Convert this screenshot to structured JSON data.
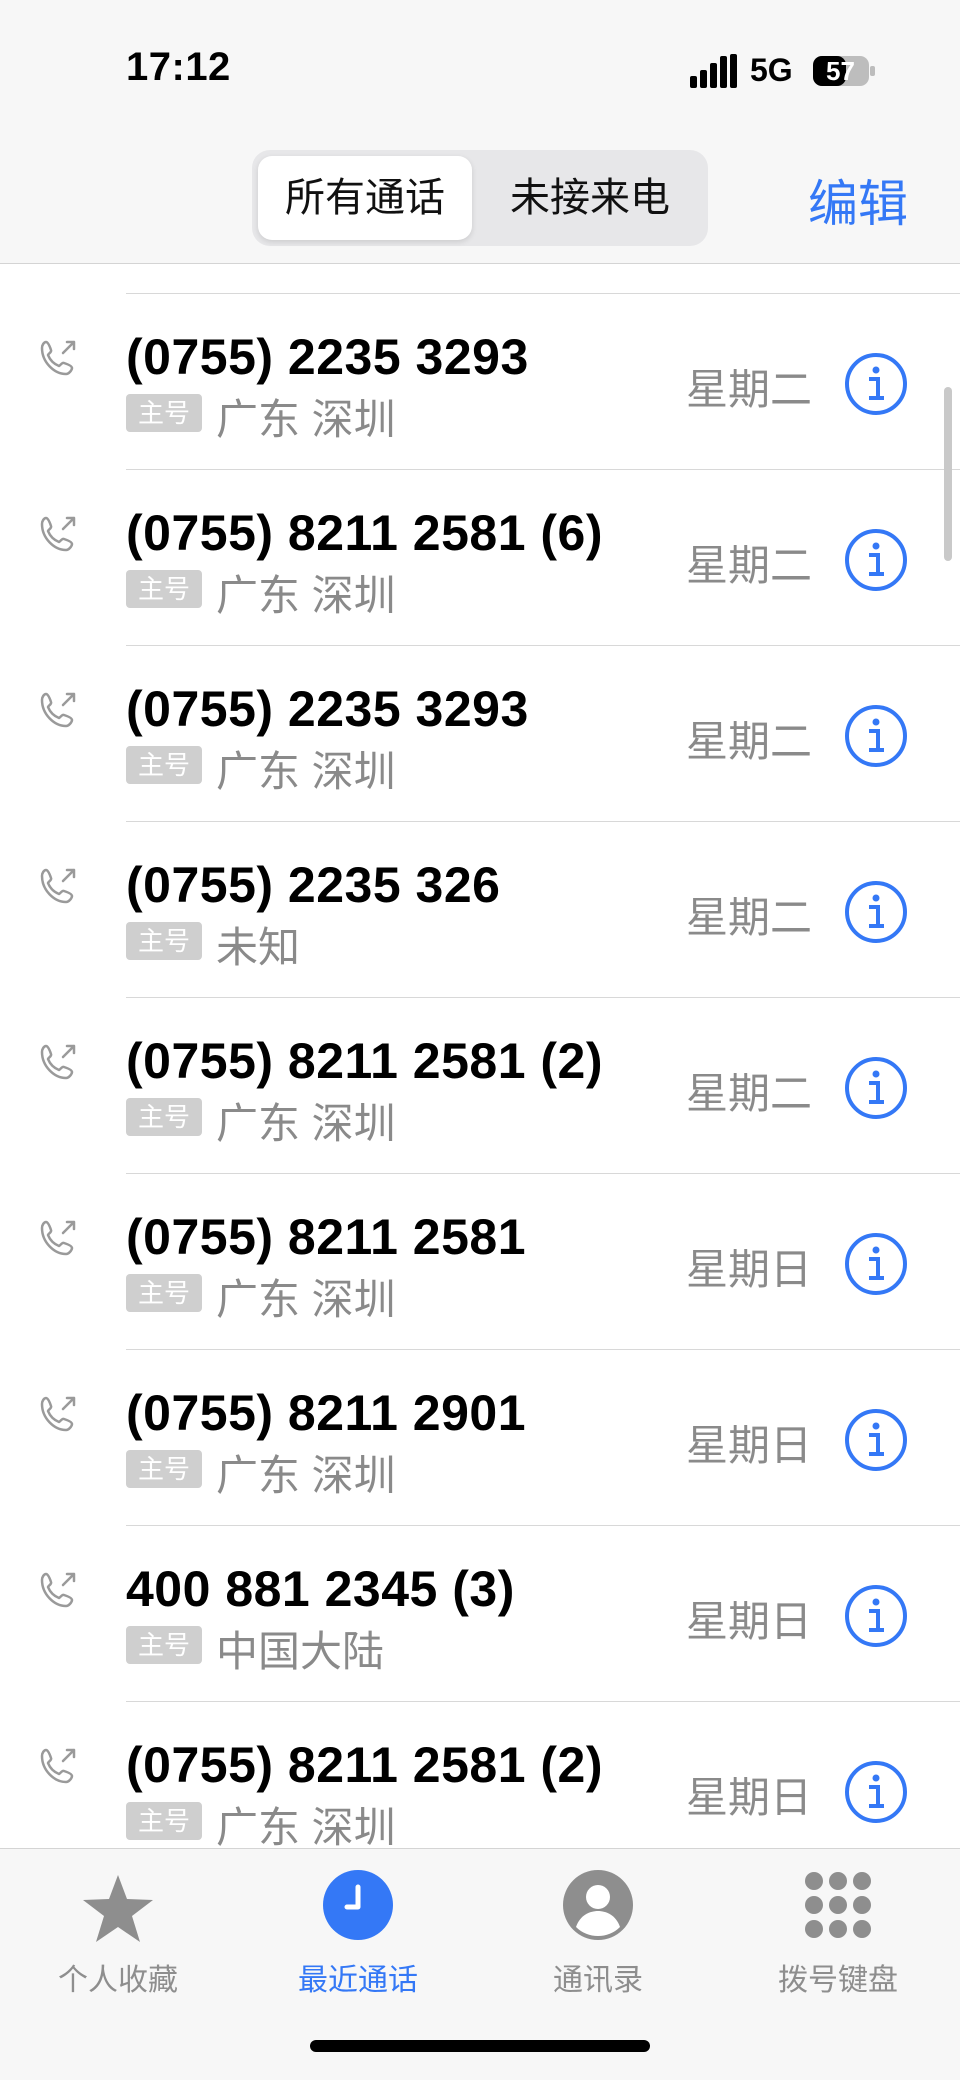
{
  "status": {
    "time": "17:12",
    "network": "5G",
    "battery": "57"
  },
  "header": {
    "segments": [
      "所有通话",
      "未接来电"
    ],
    "edit_label": "编辑"
  },
  "calls": [
    {
      "number": "(0755) 2235 3293",
      "tag": "主号",
      "location": "广东 深圳",
      "day": "星期二"
    },
    {
      "number": "(0755) 8211 2581 (6)",
      "tag": "主号",
      "location": "广东 深圳",
      "day": "星期二"
    },
    {
      "number": "(0755) 2235 3293",
      "tag": "主号",
      "location": "广东 深圳",
      "day": "星期二"
    },
    {
      "number": "(0755) 2235 326",
      "tag": "主号",
      "location": "未知",
      "day": "星期二"
    },
    {
      "number": "(0755) 8211 2581 (2)",
      "tag": "主号",
      "location": "广东 深圳",
      "day": "星期二"
    },
    {
      "number": "(0755) 8211 2581",
      "tag": "主号",
      "location": "广东 深圳",
      "day": "星期日"
    },
    {
      "number": "(0755) 8211 2901",
      "tag": "主号",
      "location": "广东 深圳",
      "day": "星期日"
    },
    {
      "number": "400 881 2345 (3)",
      "tag": "主号",
      "location": "中国大陆",
      "day": "星期日"
    },
    {
      "number": "(0755) 8211 2581 (2)",
      "tag": "主号",
      "location": "广东 深圳",
      "day": "星期日"
    }
  ],
  "tabs": [
    {
      "label": "个人收藏",
      "icon": "star-icon"
    },
    {
      "label": "最近通话",
      "icon": "clock-icon"
    },
    {
      "label": "通讯录",
      "icon": "contact-icon"
    },
    {
      "label": "拨号键盘",
      "icon": "keypad-icon"
    }
  ],
  "colors": {
    "accent": "#3478f6",
    "secondary_text": "#8a8a8a"
  }
}
